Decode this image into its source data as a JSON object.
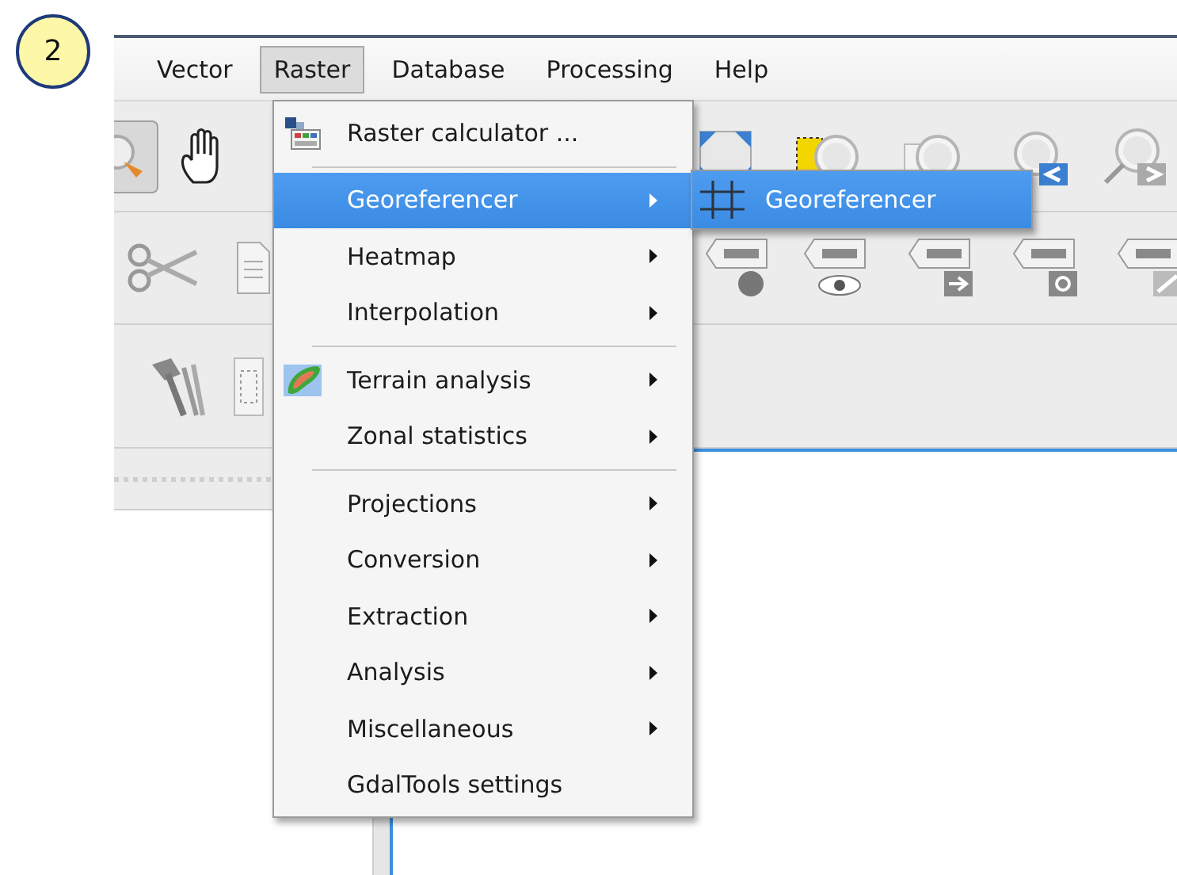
{
  "badge": "2",
  "menubar": [
    {
      "label": "Vector",
      "selected": false
    },
    {
      "label": "Raster",
      "selected": true
    },
    {
      "label": "Database",
      "selected": false
    },
    {
      "label": "Processing",
      "selected": false
    },
    {
      "label": "Help",
      "selected": false
    }
  ],
  "menu": {
    "items": [
      {
        "kind": "item",
        "label": "Raster calculator ...",
        "selected": false
      },
      {
        "kind": "separator"
      },
      {
        "kind": "submenu",
        "label": "Georeferencer",
        "selected": true
      },
      {
        "kind": "submenu",
        "label": "Heatmap",
        "selected": false
      },
      {
        "kind": "submenu",
        "label": "Interpolation",
        "selected": false
      },
      {
        "kind": "separator"
      },
      {
        "kind": "submenu",
        "label": "Terrain analysis",
        "selected": false
      },
      {
        "kind": "submenu",
        "label": "Zonal statistics",
        "selected": false
      },
      {
        "kind": "separator"
      },
      {
        "kind": "submenu",
        "label": "Projections",
        "selected": false
      },
      {
        "kind": "submenu",
        "label": "Conversion",
        "selected": false
      },
      {
        "kind": "submenu",
        "label": "Extraction",
        "selected": false
      },
      {
        "kind": "submenu",
        "label": "Analysis",
        "selected": false
      },
      {
        "kind": "submenu",
        "label": "Miscellaneous",
        "selected": false
      },
      {
        "kind": "item",
        "label": "GdalTools settings",
        "selected": false
      }
    ]
  },
  "submenu": {
    "items": [
      {
        "label": "Georeferencer",
        "selected": true
      }
    ]
  }
}
